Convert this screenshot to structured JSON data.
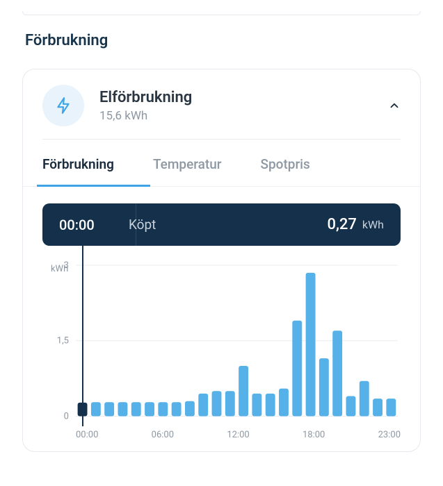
{
  "section_title": "Förbrukning",
  "card": {
    "title": "Elförbrukning",
    "subtitle": "15,6 kWh"
  },
  "tabs": {
    "consumption": "Förbrukning",
    "temperature": "Temperatur",
    "spotprice": "Spotpris"
  },
  "tooltip": {
    "time": "00:00",
    "label": "Köpt",
    "value": "0,27",
    "unit": "kWh"
  },
  "yaxis": {
    "unit": "kWh",
    "ticks": [
      "3",
      "1,5",
      "0"
    ]
  },
  "xaxis": [
    "00:00",
    "06:00",
    "12:00",
    "18:00",
    "23:00"
  ],
  "chart_data": {
    "type": "bar",
    "title": "Elförbrukning",
    "xlabel": "",
    "ylabel": "kWh",
    "ylim": [
      0,
      3
    ],
    "categories": [
      "00:00",
      "01:00",
      "02:00",
      "03:00",
      "04:00",
      "05:00",
      "06:00",
      "07:00",
      "08:00",
      "09:00",
      "10:00",
      "11:00",
      "12:00",
      "13:00",
      "14:00",
      "15:00",
      "16:00",
      "17:00",
      "18:00",
      "19:00",
      "20:00",
      "21:00",
      "22:00",
      "23:00"
    ],
    "values": [
      0.27,
      0.28,
      0.28,
      0.28,
      0.28,
      0.28,
      0.28,
      0.28,
      0.3,
      0.45,
      0.5,
      0.5,
      1.0,
      0.45,
      0.45,
      0.55,
      1.9,
      2.85,
      1.15,
      1.7,
      0.4,
      0.7,
      0.35,
      0.35
    ],
    "selected_index": 0
  },
  "colors": {
    "bar": "#56b1e8",
    "bar_selected": "#14304a",
    "grid": "#e9ecef"
  }
}
